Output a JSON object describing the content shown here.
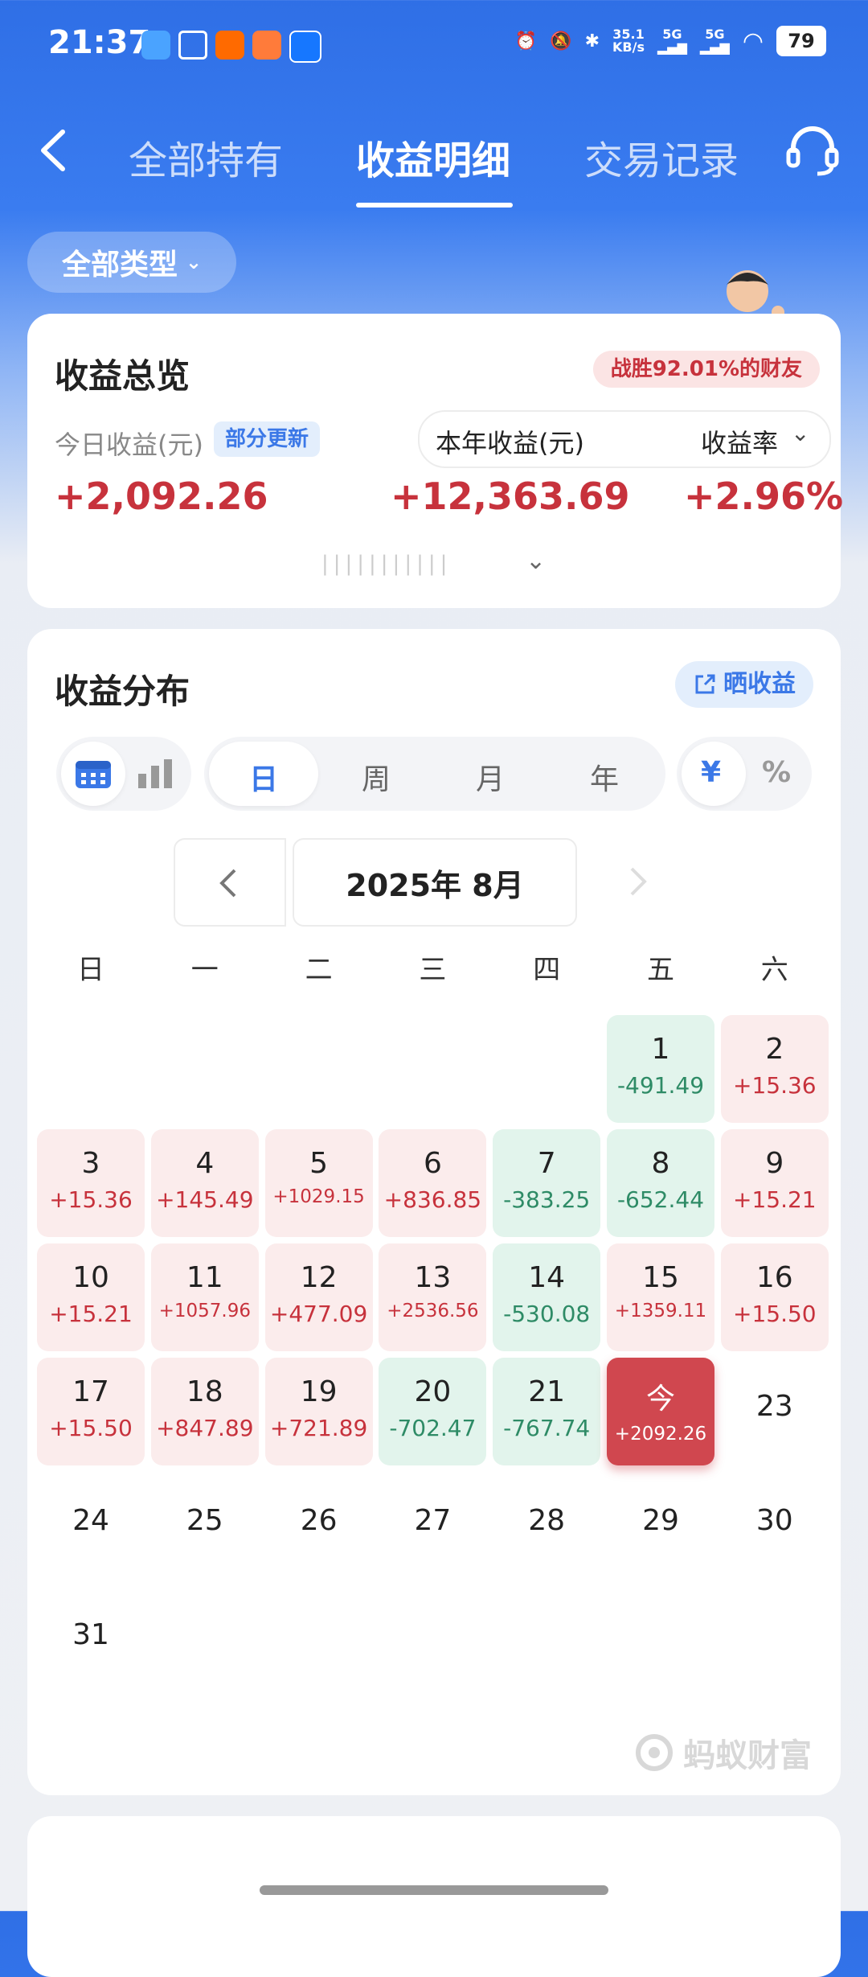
{
  "status": {
    "time": "21:37",
    "net_speed": "35.1",
    "net_unit": "KB/s",
    "sig1": "5G",
    "sig2": "5G",
    "battery": "79"
  },
  "nav": {
    "tabs": [
      {
        "label": "全部持有"
      },
      {
        "label": "收益明细"
      },
      {
        "label": "交易记录"
      }
    ],
    "active": 1
  },
  "filter": {
    "label": "全部类型"
  },
  "overview": {
    "title": "收益总览",
    "rank_badge": "战胜92.01%的财友",
    "today_label": "今日收益(元)",
    "partial_badge": "部分更新",
    "today_value": "+2,092.26",
    "year_label": "本年收益(元)",
    "rate_label": "收益率",
    "year_value": "+12,363.69",
    "rate_value": "+2.96%"
  },
  "distribution": {
    "title": "收益分布",
    "share_label": "晒收益",
    "periods": [
      "日",
      "周",
      "月",
      "年"
    ],
    "selected_period": "日",
    "units": [
      "¥",
      "%"
    ],
    "month": "2025年 8月",
    "weekdays": [
      "日",
      "一",
      "二",
      "三",
      "四",
      "五",
      "六"
    ],
    "days": [
      {
        "d": "1",
        "v": "-491.49",
        "s": "neg"
      },
      {
        "d": "2",
        "v": "+15.36",
        "s": "pos"
      },
      {
        "d": "3",
        "v": "+15.36",
        "s": "pos"
      },
      {
        "d": "4",
        "v": "+145.49",
        "s": "pos"
      },
      {
        "d": "5",
        "v": "+1029.15",
        "s": "pos"
      },
      {
        "d": "6",
        "v": "+836.85",
        "s": "pos"
      },
      {
        "d": "7",
        "v": "-383.25",
        "s": "neg"
      },
      {
        "d": "8",
        "v": "-652.44",
        "s": "neg"
      },
      {
        "d": "9",
        "v": "+15.21",
        "s": "pos"
      },
      {
        "d": "10",
        "v": "+15.21",
        "s": "pos"
      },
      {
        "d": "11",
        "v": "+1057.96",
        "s": "pos"
      },
      {
        "d": "12",
        "v": "+477.09",
        "s": "pos"
      },
      {
        "d": "13",
        "v": "+2536.56",
        "s": "pos"
      },
      {
        "d": "14",
        "v": "-530.08",
        "s": "neg"
      },
      {
        "d": "15",
        "v": "+1359.11",
        "s": "pos"
      },
      {
        "d": "16",
        "v": "+15.50",
        "s": "pos"
      },
      {
        "d": "17",
        "v": "+15.50",
        "s": "pos"
      },
      {
        "d": "18",
        "v": "+847.89",
        "s": "pos"
      },
      {
        "d": "19",
        "v": "+721.89",
        "s": "pos"
      },
      {
        "d": "20",
        "v": "-702.47",
        "s": "neg"
      },
      {
        "d": "21",
        "v": "-767.74",
        "s": "neg"
      },
      {
        "d": "今",
        "v": "+2092.26",
        "s": "today"
      },
      {
        "d": "23",
        "v": "",
        "s": "plain"
      },
      {
        "d": "24",
        "v": "",
        "s": "plain"
      },
      {
        "d": "25",
        "v": "",
        "s": "plain"
      },
      {
        "d": "26",
        "v": "",
        "s": "plain"
      },
      {
        "d": "27",
        "v": "",
        "s": "plain"
      },
      {
        "d": "28",
        "v": "",
        "s": "plain"
      },
      {
        "d": "29",
        "v": "",
        "s": "plain"
      },
      {
        "d": "30",
        "v": "",
        "s": "plain"
      },
      {
        "d": "31",
        "v": "",
        "s": "plain"
      }
    ],
    "first_weekday": 5,
    "watermark": "蚂蚁财富"
  },
  "colors": {
    "primary": "#3a7cf0",
    "up": "#c7323c",
    "down": "#2e8b66"
  }
}
